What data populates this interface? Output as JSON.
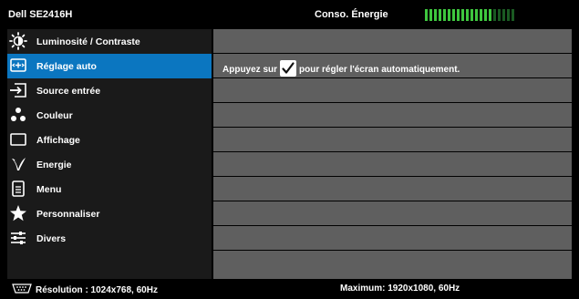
{
  "header": {
    "model": "Dell SE2416H",
    "energy_label": "Conso. Énergie",
    "energy_meter": {
      "level": 0.75,
      "segments": 20,
      "on_color": "#3ec63e",
      "off_color": "#1a5a22"
    }
  },
  "menu": {
    "items": [
      {
        "label": "Luminosité / Contraste",
        "icon": "brightness-icon"
      },
      {
        "label": "Réglage auto",
        "icon": "auto-adjust-icon",
        "active": true
      },
      {
        "label": "Source entrée",
        "icon": "input-source-icon"
      },
      {
        "label": "Couleur",
        "icon": "color-icon"
      },
      {
        "label": "Affichage",
        "icon": "display-icon"
      },
      {
        "label": "Energie",
        "icon": "energy-icon"
      },
      {
        "label": "Menu",
        "icon": "menu-icon"
      },
      {
        "label": "Personnaliser",
        "icon": "star-icon"
      },
      {
        "label": "Divers",
        "icon": "sliders-icon"
      }
    ]
  },
  "content": {
    "auto_adjust": {
      "before": "Appuyez sur",
      "after": "pour régler l'écran automatiquement."
    }
  },
  "footer": {
    "resolution": "Résolution : 1024x768, 60Hz",
    "maximum": "Maximum: 1920x1080, 60Hz"
  },
  "colors": {
    "accent": "#0b76c0",
    "row_bg": "#5f5f5f",
    "menu_bg": "#1a1a1a"
  }
}
